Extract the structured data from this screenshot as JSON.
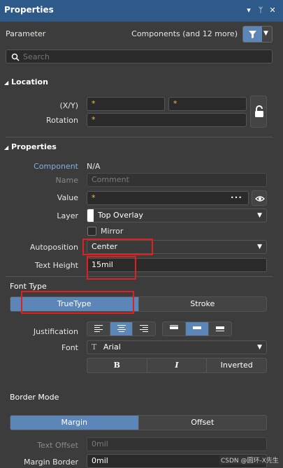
{
  "header": {
    "title": "Properties"
  },
  "filter": {
    "parameter_label": "Parameter",
    "components_label": "Components (and 12 more)"
  },
  "search": {
    "placeholder": "Search"
  },
  "location": {
    "title": "Location",
    "xy_label": "(X/Y)",
    "x_value": "*",
    "y_value": "*",
    "rotation_label": "Rotation",
    "rotation_value": "*"
  },
  "properties": {
    "title": "Properties",
    "component_label": "Component",
    "component_value": "N/A",
    "name_label": "Name",
    "name_value": "Comment",
    "value_label": "Value",
    "value_value": "*",
    "value_more": "•••",
    "layer_label": "Layer",
    "layer_value": "Top Overlay",
    "mirror_label": "Mirror",
    "autoposition_label": "Autoposition",
    "autoposition_value": "Center",
    "text_height_label": "Text Height",
    "text_height_value": "15mil"
  },
  "font_type": {
    "title": "Font Type",
    "truetype": "TrueType",
    "stroke": "Stroke",
    "justification_label": "Justification",
    "font_label": "Font",
    "font_icon": "T",
    "font_value": "Arial",
    "bold": "B",
    "italic": "I",
    "inverted": "Inverted"
  },
  "border_mode": {
    "title": "Border Mode",
    "margin": "Margin",
    "offset": "Offset",
    "text_offset_label": "Text Offset",
    "text_offset_value": "0mil",
    "margin_border_label": "Margin Border",
    "margin_border_value": "0mil"
  },
  "watermark": "CSDN @圆环-X先生",
  "colors": {
    "accent": "#5b86b7",
    "title_bar": "#2e5a8a",
    "highlight": "#e02020"
  }
}
